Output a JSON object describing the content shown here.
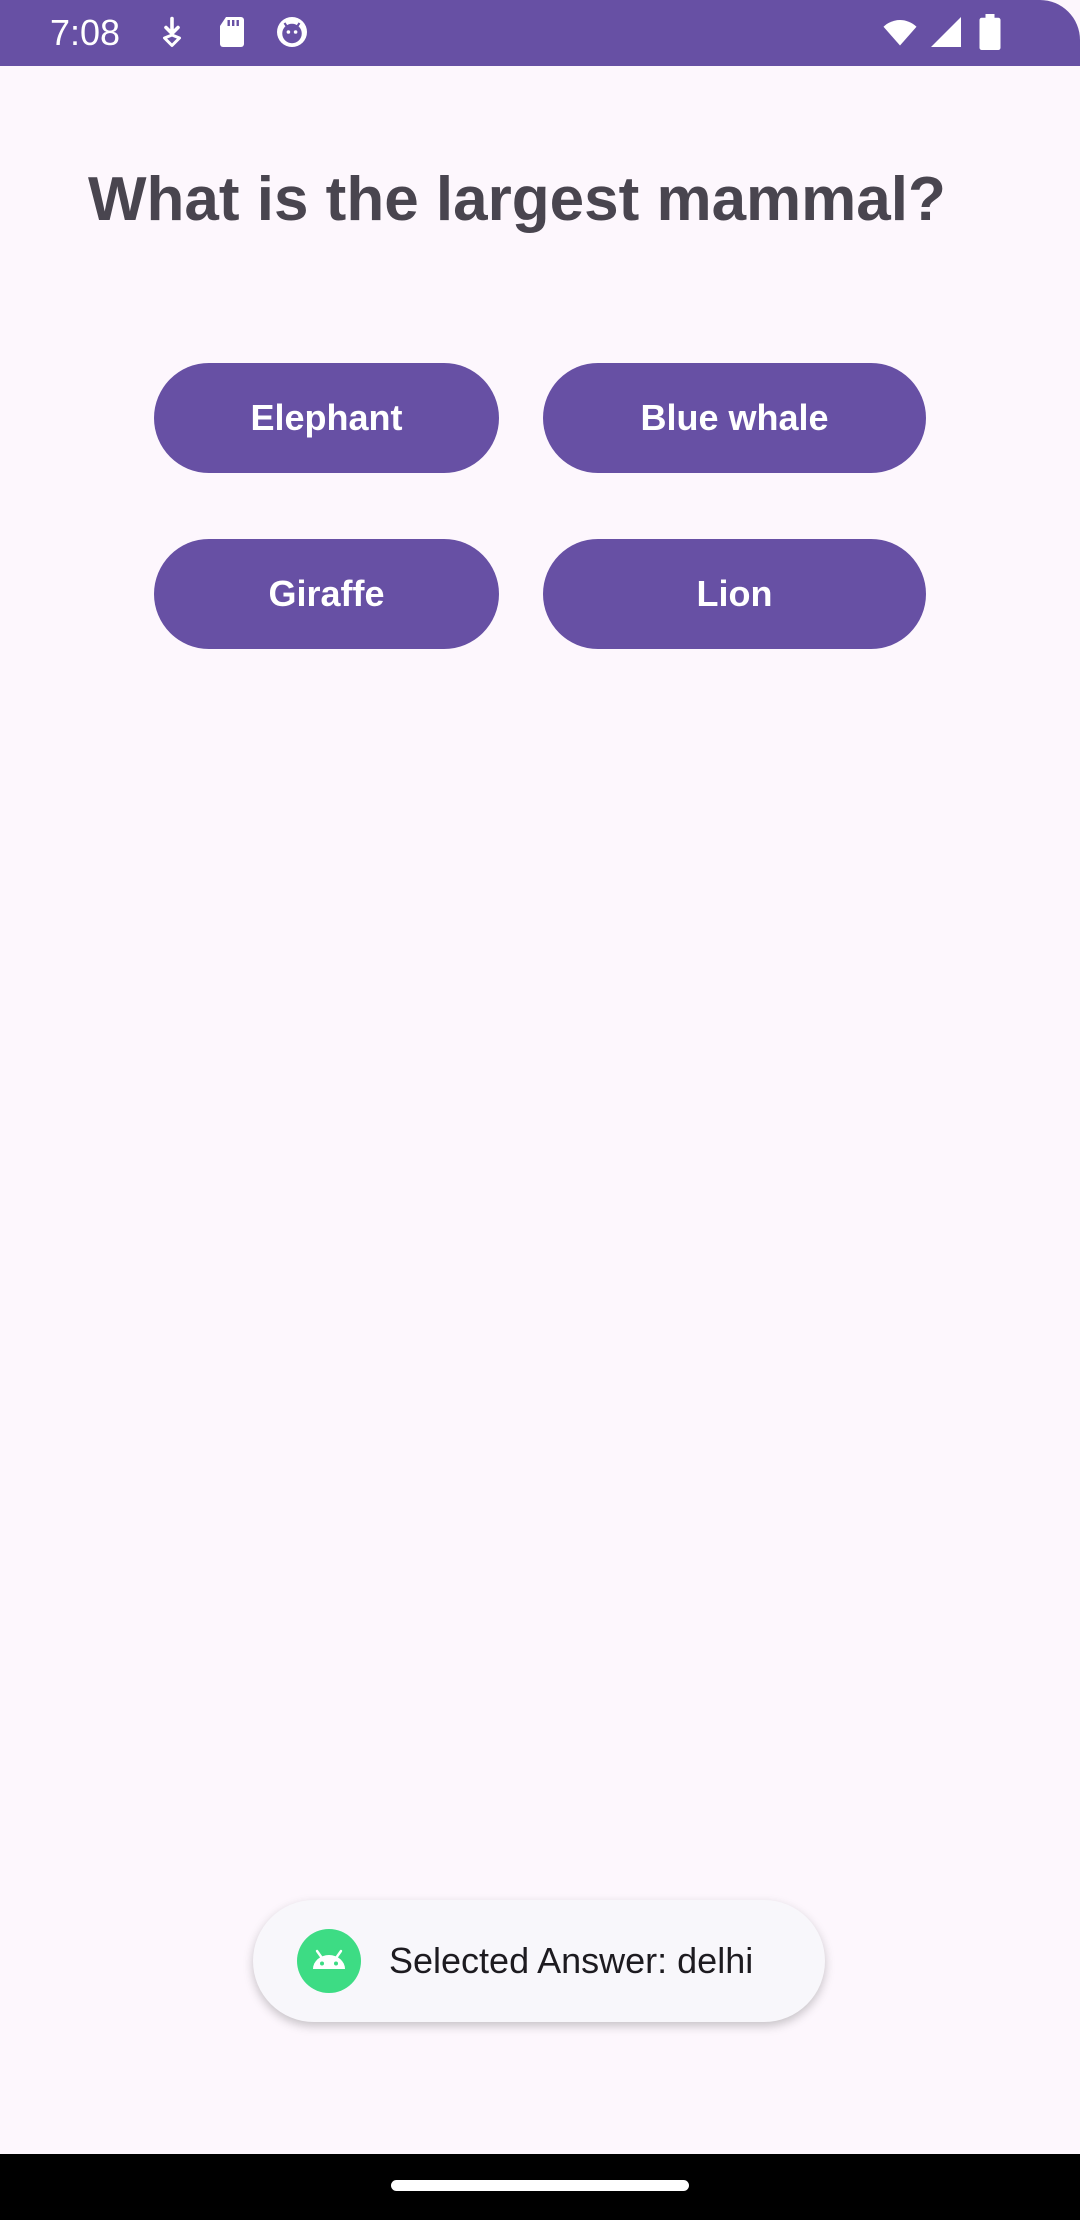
{
  "status_bar": {
    "time": "7:08",
    "left_icons": [
      "download-arrow-icon",
      "sd-card-icon",
      "android-face-icon"
    ],
    "right_icons": [
      "wifi-icon",
      "cellular-signal-icon",
      "battery-icon"
    ],
    "background_color": "#6750a4"
  },
  "question": {
    "text": "What is the largest mammal?"
  },
  "answers": [
    {
      "label": "Elephant"
    },
    {
      "label": "Blue whale"
    },
    {
      "label": "Giraffe"
    },
    {
      "label": "Lion"
    }
  ],
  "toast": {
    "icon": "android-icon",
    "text": "Selected Answer: delhi"
  },
  "colors": {
    "accent": "#6750a4",
    "background": "#fdf7fd",
    "question_text": "#49454f"
  }
}
